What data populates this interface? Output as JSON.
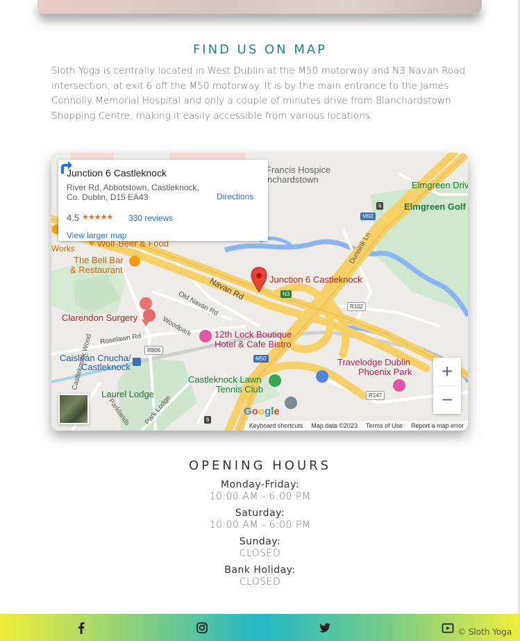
{
  "find_section": {
    "title": "FIND US ON MAP",
    "intro": "Sloth Yoga is centrally located in West Dublin at the M50 motorway and N3 Navan Road intersection, at exit 6 off the M50 motorway. It is by the main entrance to the James Connolly Memorial Hospital and only a couple of minutes drive from Blanchardstown Shopping Centre, making it easily accessible from various locations."
  },
  "map": {
    "place_name": "Junction 6 Castleknock",
    "address": "River Rd, Abbotstown, Castleknock, Co. Dublin, D15 EA43",
    "rating": "4.5",
    "stars": "★★★★★",
    "reviews": "330 reviews",
    "directions": "Directions",
    "view_larger": "View larger map",
    "pin_label": "Junction 6 Castleknock",
    "labels": {
      "francis_hospice_1": "Francis Hospice",
      "francis_hospice_2": "nchardstown",
      "elmgreen_drive": "Elmgreen Driv",
      "elmgreen_golf": "Elmgreen Golf",
      "works": "Works",
      "wolf_beer": "Wolf-Beer & Food",
      "bell_bar_1": "The Bell Bar",
      "bell_bar_2": "& Restaurant",
      "navan_rd": "Navan Rd",
      "old_navan_rd": "Old Navan Rd",
      "dunsink_ln": "Dunsink Ln",
      "clarendon": "Clarendon Surgery",
      "woodpark": "Woodpark",
      "roselawn": "Roselawn Rd",
      "lock_boutique_1": "12th Lock Boutique",
      "lock_boutique_2": "Hotel & Cafe Bistro",
      "caislean_1": "Caisleán Cnucha/",
      "caislean_2": "Castleknock",
      "travelodge_1": "Travelodge Dublin",
      "travelodge_2": "Phoenix Park",
      "lawn_tennis_1": "Castleknock Lawn",
      "lawn_tennis_2": "Tennis Club",
      "laurel_lodge": "Laurel Lodge",
      "castleknock_wood": "Castleknock Wood",
      "parklands": "Parklands",
      "park_lodge": "Park Lodge"
    },
    "shields": {
      "m50_top": "M50",
      "m50_bottom": "M50",
      "n3": "N3",
      "r102": "R102",
      "r806": "R806",
      "r147": "R147",
      "six_top": "6",
      "six_bottom": "6"
    },
    "google": [
      "G",
      "o",
      "o",
      "g",
      "l",
      "e"
    ],
    "attribution": {
      "shortcuts": "Keyboard shortcuts",
      "map_data": "Map data ©2023",
      "terms": "Terms of Use",
      "report": "Report a map error"
    },
    "zoom_in": "+",
    "zoom_out": "−"
  },
  "hours_section": {
    "title": "OPENING HOURS",
    "entries": [
      {
        "day": "Monday-Friday:",
        "time": "10:00 AM - 6:00 PM"
      },
      {
        "day": "Saturday:",
        "time": "10:00 AM - 6:00 PM"
      },
      {
        "day": "Sunday:",
        "time": "CLOSED"
      },
      {
        "day": "Bank Holiday:",
        "time": "CLOSED"
      }
    ]
  },
  "footer": {
    "copyright": "© Sloth Yoga",
    "social_icons": [
      "facebook-icon",
      "instagram-icon",
      "twitter-icon",
      "youtube-icon"
    ]
  },
  "colors": {
    "title_teal": "#22828e",
    "road_yellow": "#f6cf65",
    "water_blue": "#8ab4f8",
    "park_green": "#cde6cd",
    "link_blue": "#1a73e8"
  }
}
